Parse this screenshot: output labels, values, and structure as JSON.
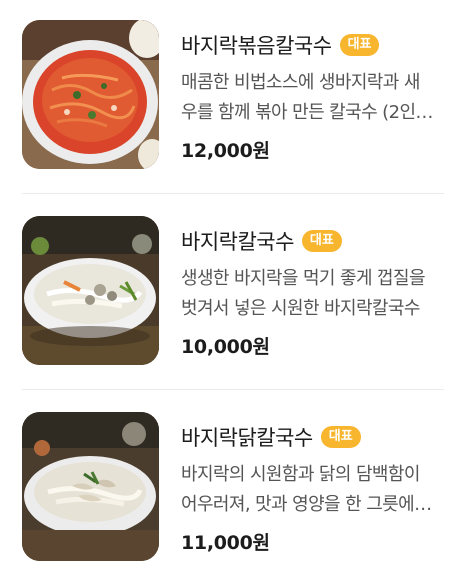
{
  "menu": [
    {
      "title": "바지락볶음칼국수",
      "badge": "대표",
      "desc_line1": "매콤한 비법소스에 생바지락과 새",
      "desc_line2": "우를 함께 볶아 만든 칼국수 (2인…",
      "price": "12,000원",
      "image_icon": "spicy-stir-fried-noodle-photo"
    },
    {
      "title": "바지락칼국수",
      "badge": "대표",
      "desc_line1": "생생한 바지락을 먹기 좋게 껍질을",
      "desc_line2": "벗겨서 넣은 시원한 바지락칼국수",
      "price": "10,000원",
      "image_icon": "clam-noodle-soup-photo"
    },
    {
      "title": "바지락닭칼국수",
      "badge": "대표",
      "desc_line1": "바지락의 시원함과 닭의 담백함이",
      "desc_line2": "어우러져, 맛과 영양을 한 그릇에…",
      "price": "11,000원",
      "image_icon": "clam-chicken-noodle-soup-photo"
    }
  ],
  "colors": {
    "badge": "#f8b52e",
    "divider": "#ececec",
    "text_primary": "#1c1c1c",
    "text_secondary": "#555555"
  }
}
